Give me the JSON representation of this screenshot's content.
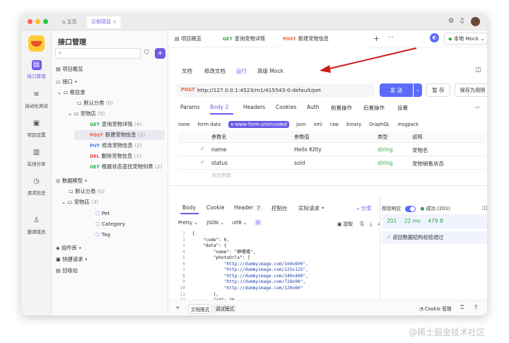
{
  "titlebar": {
    "home": "主页",
    "project_tab": "示例项目"
  },
  "rail": [
    {
      "label": "接口管理",
      "icon": "api-icon"
    },
    {
      "label": "自动化测试",
      "icon": "test-icon"
    },
    {
      "label": "项目设置",
      "icon": "settings-icon"
    },
    {
      "label": "在线分享",
      "icon": "share-icon"
    },
    {
      "label": "请求历史",
      "icon": "history-icon"
    },
    {
      "label": "邀请成员",
      "icon": "invite-icon"
    }
  ],
  "tree": {
    "title": "接口管理",
    "overview": "项目概览",
    "api": "接口",
    "root": "根目录",
    "default_cat": "默认分类",
    "default_cat_count": "(0)",
    "petstore": "宠物店",
    "petstore_count": "(5)",
    "endpoints": [
      {
        "method": "GET",
        "name": "查询宠物详情",
        "count": "(4)"
      },
      {
        "method": "POST",
        "name": "新建宠物信息",
        "count": "(1)"
      },
      {
        "method": "PUT",
        "name": "修改宠物信息",
        "count": "(2)"
      },
      {
        "method": "DEL",
        "name": "删除宠物信息",
        "count": "(1)"
      },
      {
        "method": "GET",
        "name": "根据状态查找宠物列表",
        "count": "(2)"
      }
    ],
    "models": "数据模型",
    "m_default": "默认分类",
    "m_default_count": "(0)",
    "m_petstore": "宠物店",
    "m_petstore_count": "(3)",
    "m_items": [
      "Pet",
      "Category",
      "Tag"
    ],
    "components": "组件库",
    "quick_request": "快捷请求",
    "recycle": "回收站"
  },
  "tabs": {
    "overview": "项目概览",
    "get_method": "GET",
    "get_label": "查询宠物详情",
    "post_method": "POST",
    "post_label": "新建宠物信息",
    "env": "本地 Mock"
  },
  "subtabs": [
    "文档",
    "修改文档",
    "运行",
    "高级 Mock"
  ],
  "request": {
    "method": "POST",
    "url": "http://127.0.0.1:4523/m1/415543-0-default/pet",
    "send": "发 送",
    "save": "暂 存",
    "save_case": "保存为用例"
  },
  "param_tabs": [
    "Params",
    "Body",
    "Headers",
    "Cookies",
    "Auth",
    "前置操作",
    "后置操作",
    "设置"
  ],
  "body_count": "2",
  "body_types": [
    "none",
    "form-data",
    "x-www-form-urlencoded",
    "json",
    "xml",
    "raw",
    "binary",
    "GraphQL",
    "msgpack"
  ],
  "table": {
    "headers": [
      "参数名",
      "参数值",
      "类型",
      "说明"
    ],
    "rows": [
      {
        "name": "name",
        "value": "Hello Kitty",
        "type": "string",
        "desc": "宠物名"
      },
      {
        "name": "status",
        "value": "sold",
        "type": "string",
        "desc": "宠物销售状态"
      }
    ],
    "add": "添加参数"
  },
  "resp_tabs": [
    "Body",
    "Cookie",
    "Header",
    "控制台",
    "实际请求"
  ],
  "header_count": "7",
  "share": "分享",
  "resp_toolbar": {
    "pretty": "Pretty",
    "json": "JSON",
    "utf8": "utf8",
    "extract": "提取"
  },
  "code_lines": [
    {
      "n": "1",
      "t": "{"
    },
    {
      "n": "2",
      "t": "    \"code\": 0,"
    },
    {
      "n": "3",
      "t": "    \"data\": {"
    },
    {
      "n": "4",
      "t": "        \"name\": \"薛嘻嘻\","
    },
    {
      "n": "5",
      "t": "        \"photoUrls\": ["
    },
    {
      "n": "6",
      "t": "            \"http://dummyimage.com/160x600\","
    },
    {
      "n": "7",
      "t": "            \"http://dummyimage.com/125x125\","
    },
    {
      "n": "8",
      "t": "            \"http://dummyimage.com/240x400\","
    },
    {
      "n": "9",
      "t": "            \"http://dummyimage.com/728x90\","
    },
    {
      "n": "10",
      "t": "            \"http://dummyimage.com/120x60\""
    },
    {
      "n": "11",
      "t": "        ],"
    },
    {
      "n": "12",
      "t": "        \"id\": 20,"
    }
  ],
  "validation": {
    "label": "校验响应",
    "status": "成功 (201)",
    "code": "201",
    "time": "22 ms",
    "size": "479 B",
    "message": "返回数据结构校验通过"
  },
  "bottom": {
    "doc_mode": "文档模式",
    "debug_mode": "调试模式",
    "cookie": "Cookie 管理"
  },
  "watermark": "@稀土掘金技术社区",
  "colors": {
    "accent": "#6c5ce7",
    "send": "#5b6cf9",
    "get": "#2ba84a",
    "post": "#e8622a",
    "put": "#3c6ee8",
    "del": "#e23c3c",
    "arrow": "#d11a1a"
  }
}
